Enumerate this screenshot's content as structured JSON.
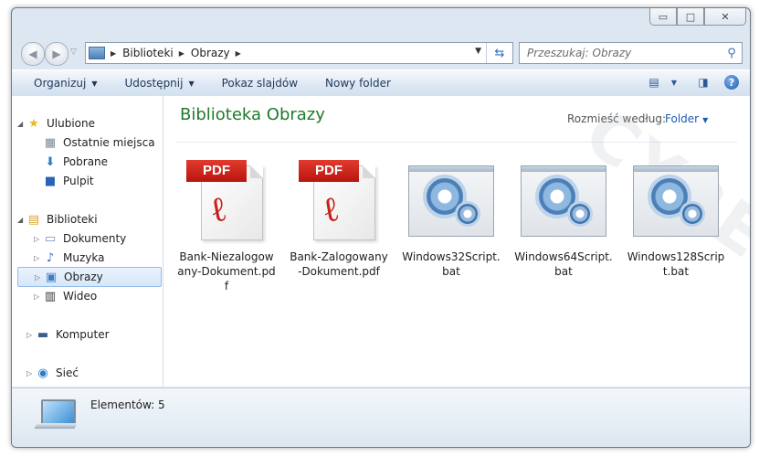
{
  "window": {
    "caption": {
      "minimize": "▭",
      "maximize": "□",
      "close": "✕"
    }
  },
  "address": {
    "crumbs": [
      "Biblioteki",
      "Obrazy"
    ],
    "back_icon": "◀",
    "forward_icon": "▶"
  },
  "search": {
    "placeholder": "Przeszukaj: Obrazy"
  },
  "toolbar": {
    "organize": "Organizuj",
    "share": "Udostępnij",
    "slideshow": "Pokaz slajdów",
    "new_folder": "Nowy folder"
  },
  "nav": {
    "favorites": "Ulubione",
    "recent": "Ostatnie miejsca",
    "downloads": "Pobrane",
    "desktop": "Pulpit",
    "libraries": "Biblioteki",
    "documents": "Dokumenty",
    "music": "Muzyka",
    "pictures": "Obrazy",
    "video": "Wideo",
    "computer": "Komputer",
    "network": "Sieć"
  },
  "content": {
    "title": "Biblioteka Obrazy",
    "arrange_label": "Rozmieść według:",
    "arrange_value": "Folder",
    "files": [
      {
        "name": "Bank-Niezalogowany-Dokument.pdf",
        "type": "pdf",
        "tag": "PDF"
      },
      {
        "name": "Bank-Zalogowany-Dokument.pdf",
        "type": "pdf",
        "tag": "PDF"
      },
      {
        "name": "Windows32Script.bat",
        "type": "bat"
      },
      {
        "name": "Windows64Script.bat",
        "type": "bat"
      },
      {
        "name": "Windows128Script.bat",
        "type": "bat"
      }
    ]
  },
  "details": {
    "count_text": "Elementów: 5"
  },
  "watermark": "CYBERBYTES"
}
